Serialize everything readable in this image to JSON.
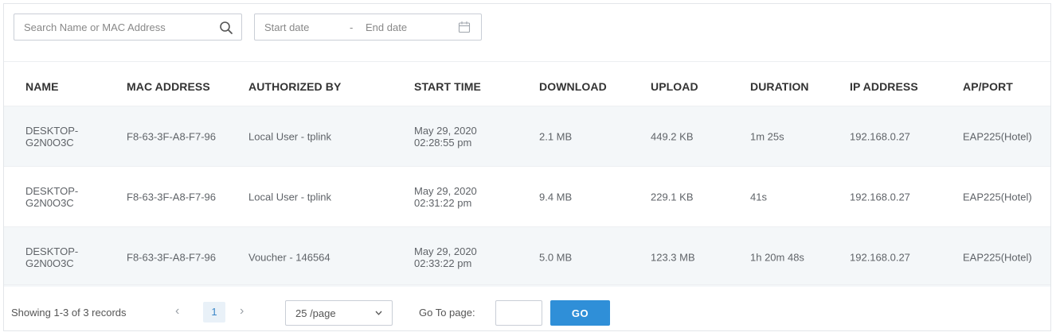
{
  "filters": {
    "search_placeholder": "Search Name or MAC Address",
    "start_date_placeholder": "Start date",
    "date_separator": "-",
    "end_date_placeholder": "End date"
  },
  "table": {
    "headers": [
      "NAME",
      "MAC ADDRESS",
      "AUTHORIZED BY",
      "START TIME",
      "DOWNLOAD",
      "UPLOAD",
      "DURATION",
      "IP ADDRESS",
      "AP/PORT"
    ],
    "rows": [
      {
        "name_line1": "DESKTOP-",
        "name_line2": "G2N0O3C",
        "mac": "F8-63-3F-A8-F7-96",
        "authorized_by": "Local User - tplink",
        "start_date": "May 29, 2020",
        "start_time": "02:28:55 pm",
        "download": "2.1 MB",
        "upload": "449.2 KB",
        "duration": "1m 25s",
        "ip": "192.168.0.27",
        "ap_port": "EAP225(Hotel)"
      },
      {
        "name_line1": "DESKTOP-",
        "name_line2": "G2N0O3C",
        "mac": "F8-63-3F-A8-F7-96",
        "authorized_by": "Local User - tplink",
        "start_date": "May 29, 2020",
        "start_time": "02:31:22 pm",
        "download": "9.4 MB",
        "upload": "229.1 KB",
        "duration": "41s",
        "ip": "192.168.0.27",
        "ap_port": "EAP225(Hotel)"
      },
      {
        "name_line1": "DESKTOP-",
        "name_line2": "G2N0O3C",
        "mac": "F8-63-3F-A8-F7-96",
        "authorized_by": "Voucher - 146564",
        "start_date": "May 29, 2020",
        "start_time": "02:33:22 pm",
        "download": "5.0 MB",
        "upload": "123.3 MB",
        "duration": "1h 20m 48s",
        "ip": "192.168.0.27",
        "ap_port": "EAP225(Hotel)"
      }
    ]
  },
  "pagination": {
    "records_text": "Showing 1-3 of 3 records",
    "prev_glyph": "‹",
    "current_page": "1",
    "next_glyph": "›",
    "per_page": "25 /page",
    "goto_label": "Go To page:",
    "goto_value": "",
    "go_label": "GO"
  },
  "colors": {
    "accent": "#2f8fd8",
    "row_shade": "#f4f7f9",
    "border": "#c9ced6"
  },
  "icons": {
    "search": "search-icon",
    "calendar": "calendar-icon",
    "prev": "chevron-left-icon",
    "next": "chevron-right-icon",
    "dropdown": "chevron-down-icon"
  }
}
